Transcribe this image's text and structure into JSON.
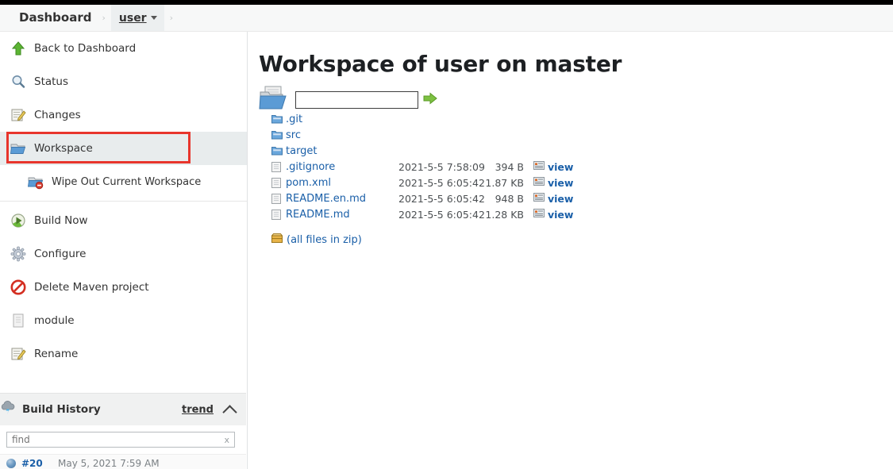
{
  "header": {
    "breadcrumb": [
      {
        "label": "Dashboard",
        "name": "breadcrumb-dashboard"
      },
      {
        "label": "user",
        "name": "breadcrumb-user"
      }
    ],
    "separator": "›"
  },
  "sidebar": {
    "items": [
      {
        "label": "Back to Dashboard",
        "icon": "up-arrow-icon"
      },
      {
        "label": "Status",
        "icon": "magnifier-icon"
      },
      {
        "label": "Changes",
        "icon": "notepad-pencil-icon"
      },
      {
        "label": "Workspace",
        "icon": "folder-icon"
      },
      {
        "label": "Wipe Out Current Workspace",
        "icon": "folder-delete-icon"
      },
      {
        "label": "Build Now",
        "icon": "build-now-icon"
      },
      {
        "label": "Configure",
        "icon": "gear-icon"
      },
      {
        "label": "Delete Maven project",
        "icon": "delete-forbidden-icon"
      },
      {
        "label": "module",
        "icon": "document-icon"
      },
      {
        "label": "Rename",
        "icon": "notepad-pencil-icon"
      }
    ],
    "build_history": {
      "title": "Build History",
      "trend_label": "trend",
      "find_value": "",
      "find_placeholder": "find",
      "clear_label": "x",
      "builds": [
        {
          "number": "#20",
          "date": "May 5, 2021 7:59 AM",
          "status": "blue"
        }
      ]
    }
  },
  "main": {
    "title": "Workspace of user on master",
    "path_input_value": "",
    "path_input_placeholder": "",
    "go_label": "",
    "files": [
      {
        "name": ".git",
        "type": "folder",
        "date": "",
        "size": "",
        "view": ""
      },
      {
        "name": "src",
        "type": "folder",
        "date": "",
        "size": "",
        "view": ""
      },
      {
        "name": "target",
        "type": "folder",
        "date": "",
        "size": "",
        "view": ""
      },
      {
        "name": ".gitignore",
        "type": "file",
        "date": "2021-5-5 7:58:09",
        "size": "394 B",
        "view": "view"
      },
      {
        "name": "pom.xml",
        "type": "file",
        "date": "2021-5-5 6:05:42",
        "size": "1.87 KB",
        "view": "view"
      },
      {
        "name": "README.en.md",
        "type": "file",
        "date": "2021-5-5 6:05:42",
        "size": "948 B",
        "view": "view"
      },
      {
        "name": "README.md",
        "type": "file",
        "date": "2021-5-5 6:05:42",
        "size": "1.28 KB",
        "view": "view"
      }
    ],
    "zip_label": "(all files in zip)"
  },
  "colors": {
    "link": "#1a5fa8",
    "highlight_border": "#e8352c",
    "selected_row": "#e8eced",
    "header_bg": "#f7f8f8"
  }
}
